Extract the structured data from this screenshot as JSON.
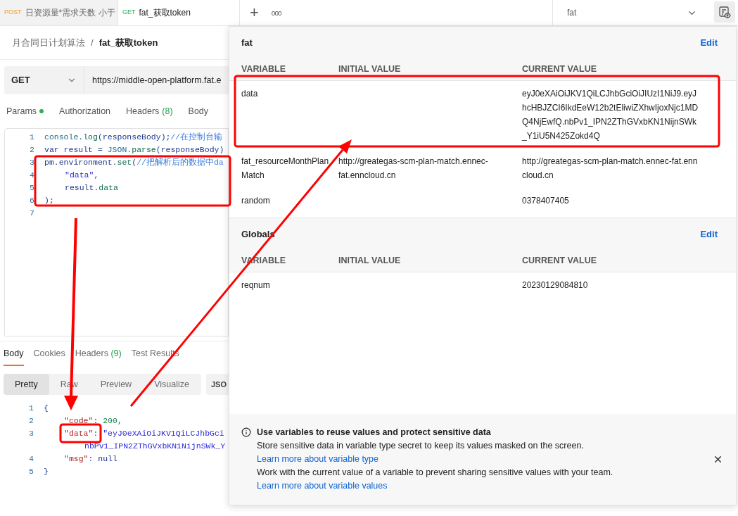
{
  "tabs": [
    {
      "method": "POST",
      "title": "日资源量*需求天数 小于",
      "selected": false
    },
    {
      "method": "GET",
      "title": "fat_获取token",
      "selected": true
    }
  ],
  "toolbar": {
    "new_tab": "+",
    "more": "ooo",
    "environment": "fat"
  },
  "breadcrumb": {
    "parent": "月合同日计划算法",
    "separator": "/",
    "current": "fat_获取token"
  },
  "request": {
    "method": "GET",
    "url": "https://middle-open-platform.fat.e"
  },
  "request_tabs": [
    {
      "label": "Params",
      "dot": true
    },
    {
      "label": "Authorization",
      "dot": false
    },
    {
      "label": "Headers",
      "count": "(8)",
      "dot": false
    },
    {
      "label": "Body",
      "dot": false
    }
  ],
  "script_lines": [
    {
      "number": "1",
      "kind": "top",
      "tokens": [
        {
          "text": "console",
          "kind": "name"
        },
        {
          "text": ".",
          "kind": "punct"
        },
        {
          "text": "log",
          "kind": "method"
        },
        {
          "text": "(responseBody);",
          "kind": "punct"
        },
        {
          "text": "//在控制台输",
          "kind": "comment"
        }
      ]
    },
    {
      "number": "2",
      "kind": "top",
      "tokens": [
        {
          "text": "var",
          "kind": "keyword"
        },
        {
          "text": "result =",
          "kind": "punct"
        },
        {
          "text": "JSON",
          "kind": "name"
        },
        {
          "text": ".",
          "kind": "punct"
        },
        {
          "text": "parse",
          "kind": "method"
        },
        {
          "text": "(responseBody)",
          "kind": "punct"
        }
      ]
    },
    {
      "number": "3",
      "kind": "top",
      "tokens": [
        {
          "text": "pm.environment.",
          "kind": "punct"
        },
        {
          "text": "set",
          "kind": "method"
        },
        {
          "text": "(",
          "kind": "punct"
        },
        {
          "text": "//把解析后的数据中da",
          "kind": "comment"
        }
      ]
    },
    {
      "number": "4",
      "kind": "inner",
      "tokens": [
        {
          "text": "\"data\"",
          "kind": "string"
        },
        {
          "text": ",",
          "kind": "punct"
        }
      ]
    },
    {
      "number": "5",
      "kind": "inner",
      "tokens": [
        {
          "text": "result.",
          "kind": "punct"
        },
        {
          "text": "data",
          "kind": "method"
        }
      ]
    },
    {
      "number": "6",
      "kind": "top",
      "tokens": [
        {
          "text": ");",
          "kind": "punct"
        }
      ]
    },
    {
      "number": "7",
      "kind": "top"
    }
  ],
  "response_tabs": [
    {
      "label": "Body",
      "selected": true
    },
    {
      "label": "Cookies",
      "selected": false
    },
    {
      "label": "Headers",
      "count": "(9)",
      "selected": false
    },
    {
      "label": "Test Results",
      "selected": false
    }
  ],
  "view_modes": [
    {
      "label": "Pretty",
      "selected": true
    },
    {
      "label": "Raw",
      "selected": false
    },
    {
      "label": "Preview",
      "selected": false
    },
    {
      "label": "Visualize",
      "selected": false
    }
  ],
  "format": "JSO",
  "response_lines": [
    {
      "number": "1",
      "kind": "top",
      "tokens": [
        {
          "text": "{",
          "kind": "punct"
        }
      ]
    },
    {
      "number": "2",
      "kind": "inner",
      "tokens": [
        {
          "text": "\"code\"",
          "kind": "key"
        },
        {
          "text": ":",
          "kind": "punct"
        },
        {
          "text": "200",
          "kind": "number"
        },
        {
          "text": ",",
          "kind": "punct"
        }
      ]
    },
    {
      "number": "3",
      "kind": "inner",
      "tokens": [
        {
          "text": "\"data\"",
          "kind": "key"
        },
        {
          "text": ":",
          "kind": "punct"
        },
        {
          "text": "\"eyJ0eXAiOiJKV1QiLCJhbGci",
          "kind": "string"
        }
      ]
    },
    {
      "kind": "wrap",
      "tokens": [
        {
          "text": "nbPv1_IPN2ZThGVxbKN1NijnSWk_Y",
          "kind": "string"
        }
      ]
    },
    {
      "number": "4",
      "kind": "inner",
      "tokens": [
        {
          "text": "\"msg\"",
          "kind": "key"
        },
        {
          "text": ":",
          "kind": "punct"
        },
        {
          "text": "null",
          "kind": "keyword"
        }
      ]
    },
    {
      "number": "5",
      "kind": "top",
      "tokens": [
        {
          "text": "}",
          "kind": "punct"
        }
      ]
    }
  ],
  "variables_panel": {
    "sections": [
      {
        "title": "fat",
        "action": "Edit",
        "columns": [
          "VARIABLE",
          "INITIAL VALUE",
          "CURRENT VALUE"
        ],
        "rows": [
          {
            "variable": "data",
            "current_value": "eyJ0eXAiOiJKV1QiLCJhbGciOiJIUzI1NiJ9.eyJhcHBJZCI6IkdEeW12b2tEliwiZXhwIjoxNjc1MDQ4NjEwfQ.nbPv1_IPN2ZThGVxbKN1NijnSWk_Y1iU5N425Zokd4Q"
          },
          {
            "variable": "fat_resourceMonthPlanMatch",
            "initial_value": "http://greategas-scm-plan-match.ennec-fat.enncloud.cn",
            "current_value": "http://greategas-scm-plan-match.ennec-fat.enncloud.cn"
          },
          {
            "variable": "random",
            "current_value": "0378407405"
          }
        ]
      },
      {
        "title": "Globals",
        "action": "Edit",
        "columns": [
          "VARIABLE",
          "INITIAL VALUE",
          "CURRENT VALUE"
        ],
        "rows": [
          {
            "variable": "reqnum",
            "current_value": "20230129084810"
          }
        ]
      }
    ],
    "info": {
      "title": "Use variables to reuse values and protect sensitive data",
      "paragraphs": [
        {
          "text": "Store sensitive data in variable type secret to keep its values masked on the screen.",
          "link": "Learn more about variable type"
        },
        {
          "text": "Work with the current value of a variable to prevent sharing sensitive values with your team.",
          "link": "Learn more about variable values"
        }
      ]
    }
  }
}
